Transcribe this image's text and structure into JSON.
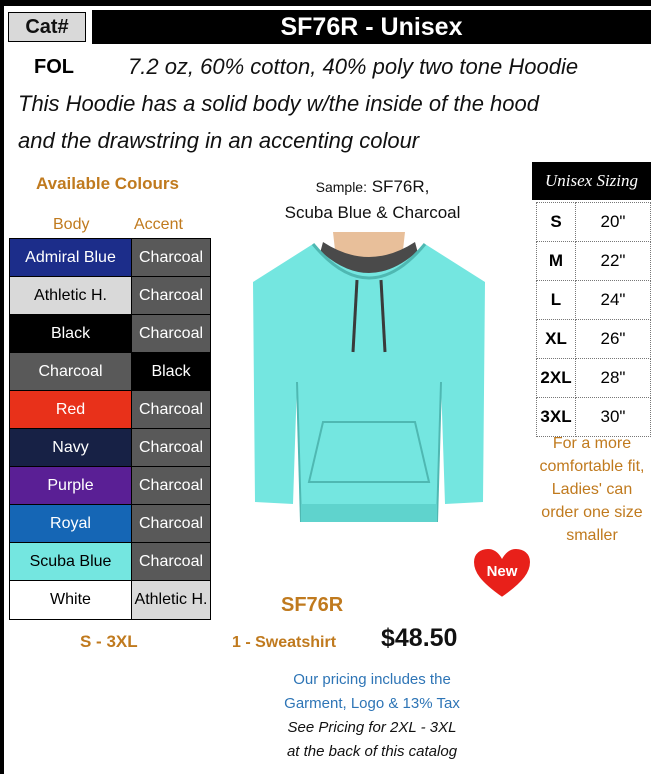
{
  "header": {
    "cat_label": "Cat#",
    "title": "SF76R - Unisex"
  },
  "description": {
    "brand": "FOL",
    "line1": "7.2 oz, 60% cotton, 40% poly two tone Hoodie",
    "line2": "This Hoodie has a solid body w/the inside of the hood",
    "line3": "and the drawstring in an accenting colour"
  },
  "colours": {
    "heading": "Available Colours",
    "body_header": "Body",
    "accent_header": "Accent",
    "rows": [
      {
        "body": "Admiral Blue",
        "body_bg": "#1c2d8a",
        "body_fg": "#ffffff",
        "accent": "Charcoal",
        "accent_bg": "#595959",
        "accent_fg": "#ffffff"
      },
      {
        "body": "Athletic H.",
        "body_bg": "#d9d9d9",
        "body_fg": "#000000",
        "accent": "Charcoal",
        "accent_bg": "#595959",
        "accent_fg": "#ffffff"
      },
      {
        "body": "Black",
        "body_bg": "#000000",
        "body_fg": "#ffffff",
        "accent": "Charcoal",
        "accent_bg": "#595959",
        "accent_fg": "#ffffff"
      },
      {
        "body": "Charcoal",
        "body_bg": "#595959",
        "body_fg": "#ffffff",
        "accent": "Black",
        "accent_bg": "#000000",
        "accent_fg": "#ffffff"
      },
      {
        "body": "Red",
        "body_bg": "#e8311a",
        "body_fg": "#ffffff",
        "accent": "Charcoal",
        "accent_bg": "#595959",
        "accent_fg": "#ffffff"
      },
      {
        "body": "Navy",
        "body_bg": "#172145",
        "body_fg": "#ffffff",
        "accent": "Charcoal",
        "accent_bg": "#595959",
        "accent_fg": "#ffffff"
      },
      {
        "body": "Purple",
        "body_bg": "#5a1f95",
        "body_fg": "#ffffff",
        "accent": "Charcoal",
        "accent_bg": "#595959",
        "accent_fg": "#ffffff"
      },
      {
        "body": "Royal",
        "body_bg": "#1566b5",
        "body_fg": "#ffffff",
        "accent": "Charcoal",
        "accent_bg": "#595959",
        "accent_fg": "#ffffff"
      },
      {
        "body": "Scuba Blue",
        "body_bg": "#74e6e0",
        "body_fg": "#000000",
        "accent": "Charcoal",
        "accent_bg": "#595959",
        "accent_fg": "#ffffff"
      },
      {
        "body": "White",
        "body_bg": "#ffffff",
        "body_fg": "#000000",
        "accent": "Athletic H.",
        "accent_bg": "#d9d9d9",
        "accent_fg": "#000000"
      }
    ],
    "size_range": "S - 3XL"
  },
  "sample": {
    "label": "Sample:",
    "code": "SF76R,",
    "colours": "Scuba Blue & Charcoal"
  },
  "sizing": {
    "heading": "Unisex Sizing",
    "rows": [
      {
        "size": "S",
        "value": "20\""
      },
      {
        "size": "M",
        "value": "22\""
      },
      {
        "size": "L",
        "value": "24\""
      },
      {
        "size": "XL",
        "value": "26\""
      },
      {
        "size": "2XL",
        "value": "28\""
      },
      {
        "size": "3XL",
        "value": "30\""
      }
    ],
    "note": "For a more comfortable fit, Ladies' can order one size smaller"
  },
  "badge": {
    "label": "New",
    "color": "#e8201a"
  },
  "pricing": {
    "sku": "SF76R",
    "quantity": "1 - Sweatshirt",
    "price": "$48.50",
    "note1": "Our pricing includes the",
    "note2": "Garment, Logo & 13% Tax",
    "note3": "See Pricing for  2XL - 3XL",
    "note4": "at the back of this catalog"
  }
}
